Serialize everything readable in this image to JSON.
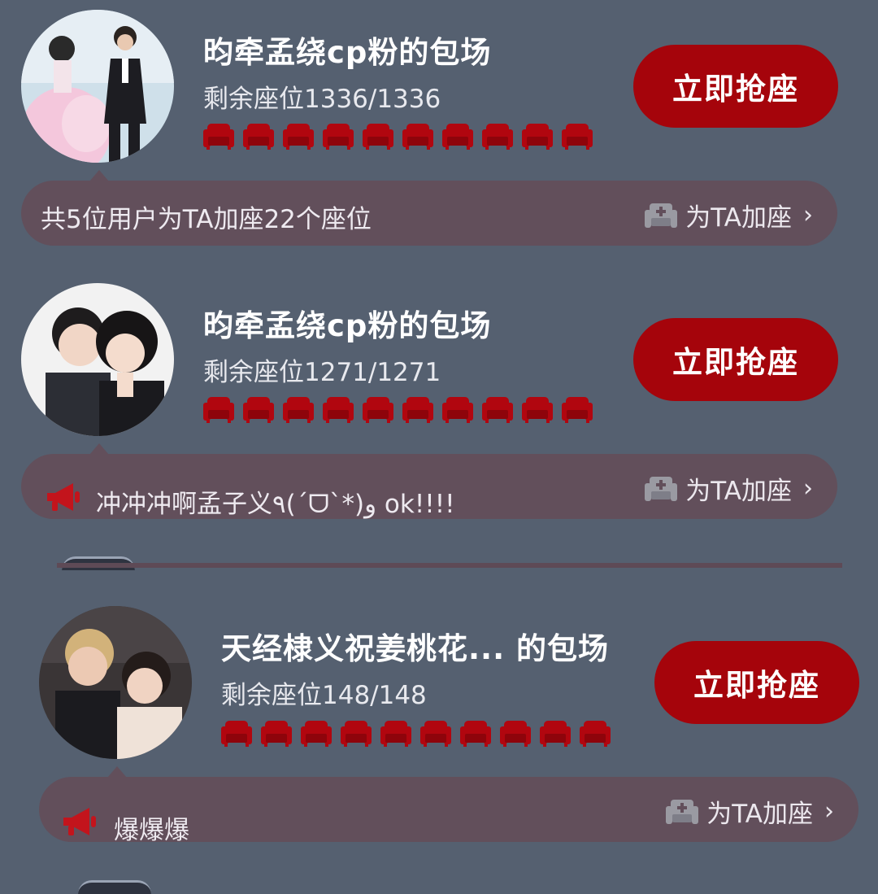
{
  "items": [
    {
      "title": "昀牵孟绕cp粉的包场",
      "seats_text": "剩余座位1336/1336",
      "button": "立即抢座",
      "bubble_text": "共5位用户为TA加座22个座位",
      "add_seat": "为TA加座",
      "avatar": "couple-photo-wedding"
    },
    {
      "title": "昀牵孟绕cp粉的包场",
      "seats_text": "剩余座位1271/1271",
      "button": "立即抢座",
      "bubble_text": "冲冲冲啊孟子义٩(ˊᗜˋ*)و ok!!!!",
      "add_seat": "为TA加座",
      "avatar": "couple-photo-portrait"
    },
    {
      "title": "天经棣义祝姜桃花... 的包场",
      "seats_text": "剩余座位148/148",
      "button": "立即抢座",
      "bubble_text": "爆爆爆",
      "add_seat": "为TA加座",
      "avatar": "couple-photo-event"
    }
  ],
  "icons": {
    "seat": "armchair-icon",
    "add_seat": "add-seat-icon",
    "horn": "megaphone-icon",
    "chevron": "chevron-right-icon"
  },
  "colors": {
    "background": "#556070",
    "accent_red": "#a5040b",
    "bubble": "#624f5b"
  },
  "chevron": "›"
}
